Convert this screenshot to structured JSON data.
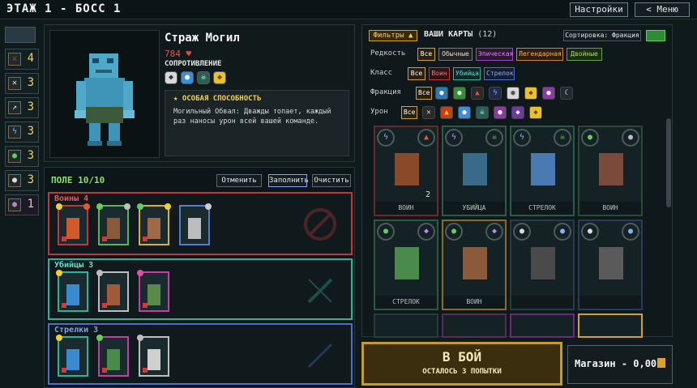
{
  "header": {
    "title": "ЭТАЖ 1 - БОСС 1",
    "settings_label": "Настройки",
    "menu_label": "< Меню"
  },
  "sidebar": {
    "badges": [
      {
        "icon": "sword-icon",
        "value": "4"
      },
      {
        "icon": "crossed-daggers-icon",
        "value": "3"
      },
      {
        "icon": "arrows-icon",
        "value": "3"
      },
      {
        "icon": "lightning-icon",
        "value": "3"
      },
      {
        "icon": "leaf-icon",
        "value": "3"
      },
      {
        "icon": "ghost-icon",
        "value": "3"
      },
      {
        "icon": "orb-icon",
        "value": "1"
      }
    ]
  },
  "boss": {
    "name": "Страж Могил",
    "hp": "784",
    "resistance_label": "СОПРОТИВЛЕНИЕ",
    "resistances": [
      "shield",
      "water",
      "skull",
      "gold"
    ],
    "ability_title": "ОСОБАЯ СПОСОБНОСТЬ",
    "ability_text": "Могильный Обвал: Дважды топает, каждый раз наносы урон всей вашей команде."
  },
  "field": {
    "title": "ПОЛЕ 10/10",
    "cancel_label": "Отменить",
    "fill_label": "Заполнить",
    "clear_label": "Очистить",
    "groups": [
      {
        "label": "Воины 4",
        "color": "#c0363a",
        "heroes": 4
      },
      {
        "label": "Убийцы 3",
        "color": "#2bb39a",
        "heroes": 3
      },
      {
        "label": "Стрелки 3",
        "color": "#4f6fc4",
        "heroes": 3
      }
    ]
  },
  "cards": {
    "filters_label": "Фильтры",
    "title": "ВАШИ КАРТЫ",
    "count": "(12)",
    "sort_label": "Сортировка: Фракция",
    "rarity_label": "Редкость",
    "rarity_options": [
      "Все",
      "Обычные",
      "Эпическая",
      "Легендарная",
      "Двойные"
    ],
    "class_label": "Класс",
    "class_options": [
      "Все",
      "Воин",
      "Убийца",
      "Стрелок"
    ],
    "faction_label": "Фракция",
    "faction_all": "Все",
    "damage_label": "Урон",
    "damage_all": "Все",
    "grid": [
      {
        "label": "ВОИН",
        "badge": "2"
      },
      {
        "label": "УБИЙЦА",
        "badge": ""
      },
      {
        "label": "СТРЕЛОК",
        "badge": ""
      },
      {
        "label": "ВОИН",
        "badge": ""
      },
      {
        "label": "СТРЕЛОК",
        "badge": ""
      },
      {
        "label": "ВОИН",
        "badge": ""
      },
      {
        "label": "",
        "badge": ""
      },
      {
        "label": "",
        "badge": ""
      }
    ]
  },
  "actions": {
    "fight_label": "В БОЙ",
    "attempts_label": "ОСТАЛОСЬ 3 ПОПЫТКИ",
    "shop_label": "Магазин - 0,00"
  }
}
